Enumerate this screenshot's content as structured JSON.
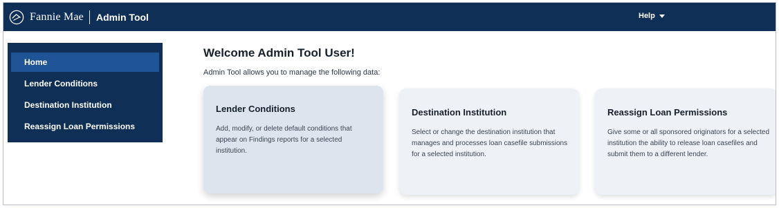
{
  "header": {
    "brand_name": "Fannie Mae",
    "app_name": "Admin Tool",
    "help_label": "Help"
  },
  "sidebar": {
    "items": [
      {
        "label": "Home",
        "active": true
      },
      {
        "label": "Lender Conditions",
        "active": false
      },
      {
        "label": "Destination Institution",
        "active": false
      },
      {
        "label": "Reassign Loan Permissions",
        "active": false
      }
    ]
  },
  "main": {
    "title": "Welcome Admin Tool User!",
    "intro": "Admin Tool allows you to manage the following data:",
    "cards": [
      {
        "title": "Lender Conditions",
        "description": "Add, modify, or delete default conditions that appear on Findings reports for a selected institution."
      },
      {
        "title": "Destination Institution",
        "description": "Select or change the destination institution that manages and processes loan casefile submissions for a selected institution."
      },
      {
        "title": "Reassign Loan Permissions",
        "description": "Give some or all sponsored originators for a selected institution the ability to release loan casefiles and submit them to a different lender."
      }
    ]
  },
  "colors": {
    "header_bg": "#0f2f57",
    "sidebar_active": "#1f5596",
    "card_highlight": "#dde4ed",
    "card_bg": "#eef1f6"
  },
  "icons": {
    "brand_logo": "fannie-mae-house-logo-icon",
    "help_caret": "caret-down-icon"
  }
}
